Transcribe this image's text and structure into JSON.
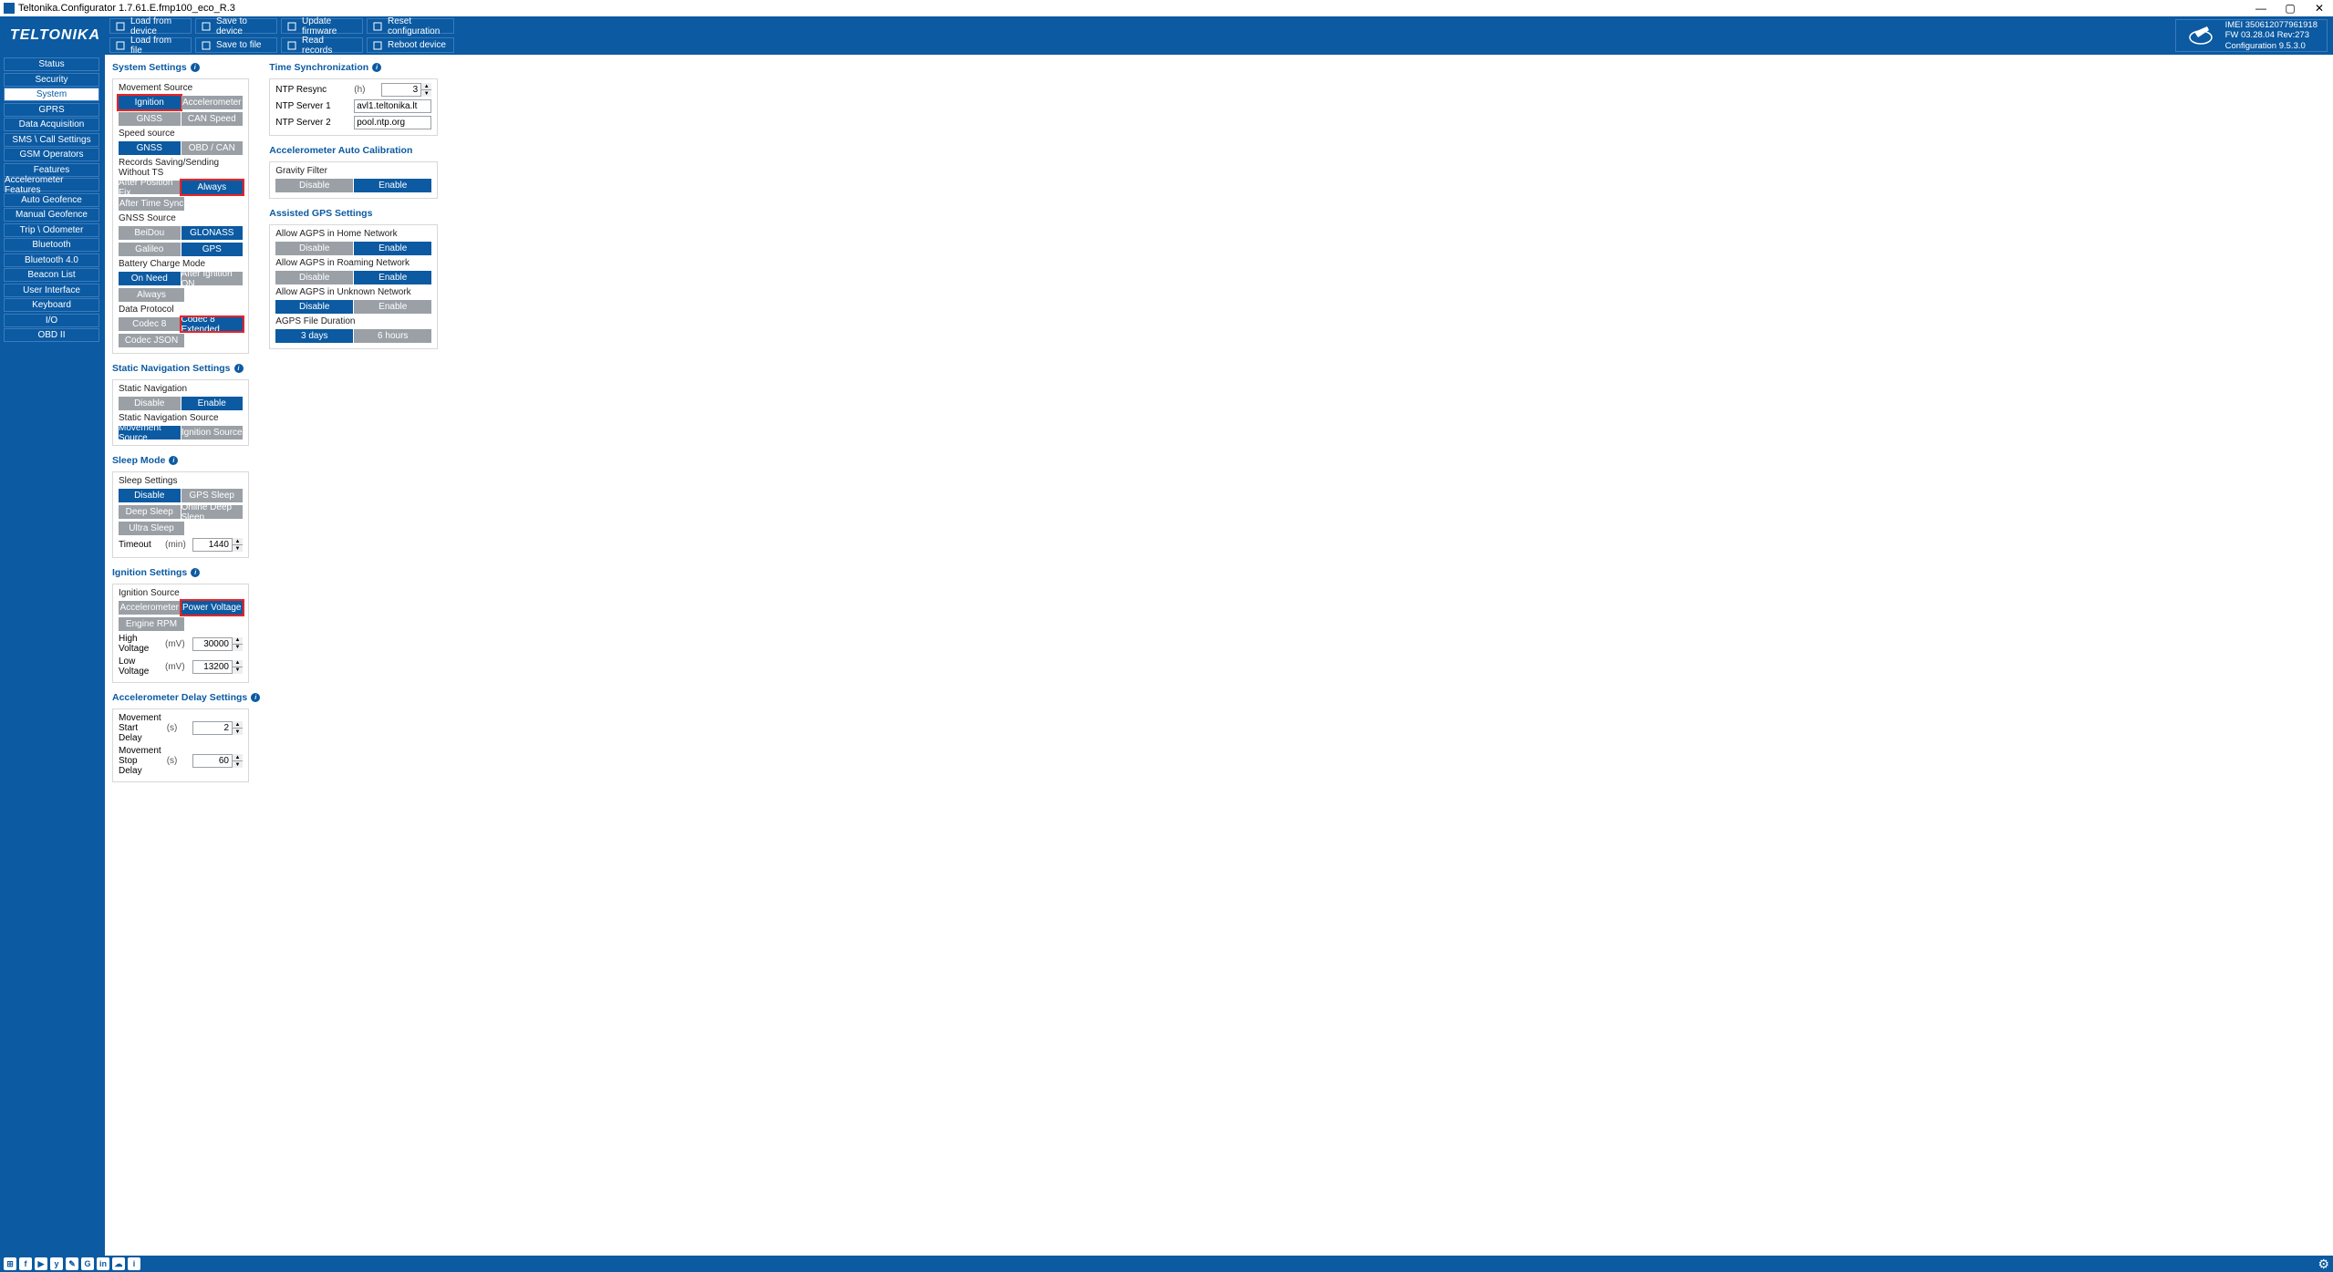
{
  "window": {
    "title": "Teltonika.Configurator 1.7.61.E.fmp100_eco_R.3",
    "min": "—",
    "max": "▢",
    "close": "✕"
  },
  "logo_text": "TELTONIKA",
  "toolbar": {
    "row1": [
      {
        "icon": "download-icon",
        "label": "Load from device"
      },
      {
        "icon": "save-icon",
        "label": "Save to device"
      },
      {
        "icon": "update-icon",
        "label": "Update firmware"
      },
      {
        "icon": "reset-icon",
        "label": "Reset configuration"
      }
    ],
    "row2": [
      {
        "icon": "fileopen-icon",
        "label": "Load from file"
      },
      {
        "icon": "filesave-icon",
        "label": "Save to file"
      },
      {
        "icon": "records-icon",
        "label": "Read records"
      },
      {
        "icon": "reboot-icon",
        "label": "Reboot device"
      }
    ]
  },
  "devinfo": {
    "imei": "IMEI 350612077961918",
    "fw": "FW 03.28.04 Rev:273",
    "conf": "Configuration 9.5.3.0"
  },
  "sidebar": {
    "items": [
      "Status",
      "Security",
      "System",
      "GPRS",
      "Data Acquisition",
      "SMS \\ Call Settings",
      "GSM Operators",
      "Features",
      "Accelerometer Features",
      "Auto Geofence",
      "Manual Geofence",
      "Trip \\ Odometer",
      "Bluetooth",
      "Bluetooth 4.0",
      "Beacon List",
      "User Interface",
      "Keyboard",
      "I/O",
      "OBD II"
    ],
    "selected": 2
  },
  "system_settings": {
    "head": "System Settings",
    "movement_source": {
      "label": "Movement Source",
      "opts": [
        "Ignition",
        "Accelerometer",
        "GNSS",
        "CAN Speed"
      ],
      "selected": 0,
      "highlight": true
    },
    "speed_source": {
      "label": "Speed source",
      "opts": [
        "GNSS",
        "OBD / CAN"
      ],
      "selected": 0
    },
    "records_nots": {
      "label": "Records Saving/Sending Without TS",
      "opts": [
        "After Position Fix",
        "Always",
        "After Time Sync"
      ],
      "selected": 1,
      "highlight": true
    },
    "gnss_source": {
      "label": "GNSS Source",
      "opts": [
        "BeiDou",
        "GLONASS",
        "Galileo",
        "GPS"
      ],
      "selected": [
        1,
        3
      ]
    },
    "battery_charge": {
      "label": "Battery Charge Mode",
      "opts": [
        "On Need",
        "After Ignition ON",
        "Always"
      ],
      "selected": 0
    },
    "data_protocol": {
      "label": "Data Protocol",
      "opts": [
        "Codec 8",
        "Codec 8 Extended",
        "Codec JSON"
      ],
      "selected": 1,
      "highlight": true
    }
  },
  "static_nav": {
    "head": "Static Navigation Settings",
    "static_navigation": {
      "label": "Static Navigation",
      "opts": [
        "Disable",
        "Enable"
      ],
      "selected": 1
    },
    "source": {
      "label": "Static Navigation Source",
      "opts": [
        "Movement Source",
        "Ignition Source"
      ],
      "selected": 0
    }
  },
  "sleep_mode": {
    "head": "Sleep Mode",
    "sleep_settings": {
      "label": "Sleep Settings",
      "opts": [
        "Disable",
        "GPS Sleep",
        "Deep Sleep",
        "Online Deep Sleep",
        "Ultra Sleep"
      ],
      "selected": 0
    },
    "timeout": {
      "label": "Timeout",
      "unit": "(min)",
      "value": "1440"
    }
  },
  "ignition_settings": {
    "head": "Ignition Settings",
    "source": {
      "label": "Ignition Source",
      "opts": [
        "Accelerometer",
        "Power Voltage",
        "Engine RPM"
      ],
      "selected": 1,
      "highlight": true
    },
    "high_v": {
      "label": "High Voltage",
      "unit": "(mV)",
      "value": "30000"
    },
    "low_v": {
      "label": "Low Voltage",
      "unit": "(mV)",
      "value": "13200"
    }
  },
  "accel_delay": {
    "head": "Accelerometer Delay Settings",
    "start": {
      "label": "Movement Start Delay",
      "unit": "(s)",
      "value": "2"
    },
    "stop": {
      "label": "Movement Stop Delay",
      "unit": "(s)",
      "value": "60"
    }
  },
  "time_sync": {
    "head": "Time Synchronization",
    "resync": {
      "label": "NTP Resync",
      "unit": "(h)",
      "value": "3"
    },
    "server1": {
      "label": "NTP Server 1",
      "value": "avl1.teltonika.lt"
    },
    "server2": {
      "label": "NTP Server 2",
      "value": "pool.ntp.org"
    }
  },
  "accel_cal": {
    "head": "Accelerometer Auto Calibration",
    "gravity": {
      "label": "Gravity Filter",
      "opts": [
        "Disable",
        "Enable"
      ],
      "selected": 1
    }
  },
  "agps": {
    "head": "Assisted GPS Settings",
    "home": {
      "label": "Allow AGPS in Home Network",
      "opts": [
        "Disable",
        "Enable"
      ],
      "selected": 1
    },
    "roaming": {
      "label": "Allow AGPS in Roaming Network",
      "opts": [
        "Disable",
        "Enable"
      ],
      "selected": 1
    },
    "unknown": {
      "label": "Allow AGPS in Unknown Network",
      "opts": [
        "Disable",
        "Enable"
      ],
      "selected": 0
    },
    "duration": {
      "label": "AGPS File Duration",
      "opts": [
        "3 days",
        "6 hours"
      ],
      "selected": 0
    }
  },
  "footer_icons": [
    "⊞",
    "f",
    "▶",
    "y",
    "✎",
    "G",
    "in",
    "☁",
    "i"
  ]
}
